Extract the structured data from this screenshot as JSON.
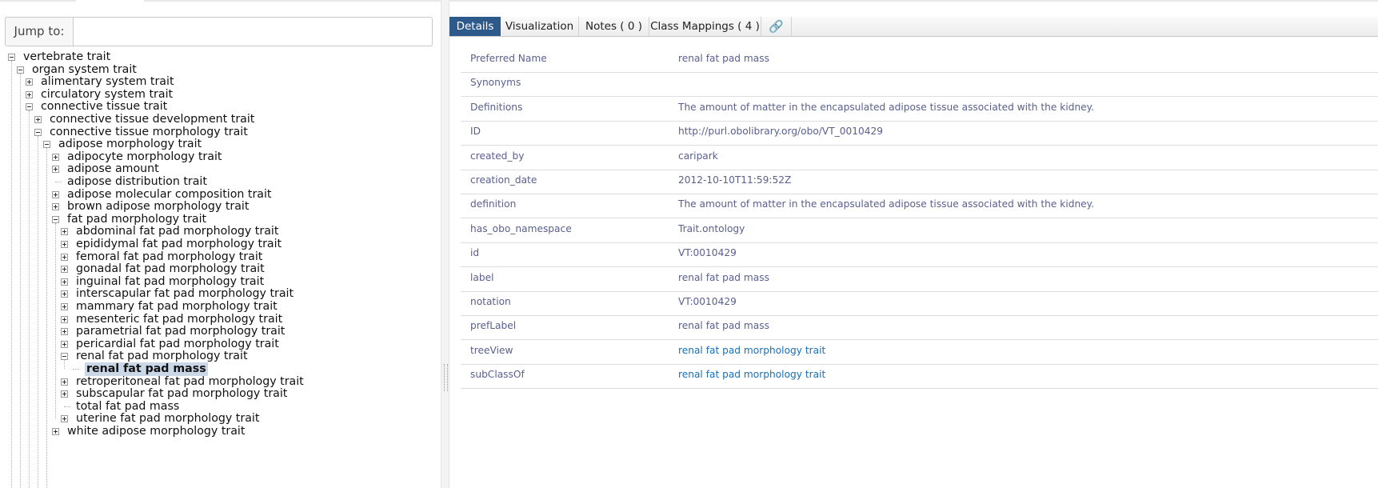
{
  "jump": {
    "label": "Jump to:",
    "value": "",
    "placeholder": ""
  },
  "tree": {
    "nodes": [
      {
        "label": "vertebrate trait",
        "depth": 0,
        "toggle": "minus"
      },
      {
        "label": "organ system trait",
        "depth": 1,
        "toggle": "minus"
      },
      {
        "label": "alimentary system trait",
        "depth": 2,
        "toggle": "plus"
      },
      {
        "label": "circulatory system trait",
        "depth": 2,
        "toggle": "plus"
      },
      {
        "label": "connective tissue trait",
        "depth": 2,
        "toggle": "minus"
      },
      {
        "label": "connective tissue development trait",
        "depth": 3,
        "toggle": "plus"
      },
      {
        "label": "connective tissue morphology trait",
        "depth": 3,
        "toggle": "minus"
      },
      {
        "label": "adipose morphology trait",
        "depth": 4,
        "toggle": "minus"
      },
      {
        "label": "adipocyte morphology trait",
        "depth": 5,
        "toggle": "plus"
      },
      {
        "label": "adipose amount",
        "depth": 5,
        "toggle": "plus"
      },
      {
        "label": "adipose distribution trait",
        "depth": 5,
        "toggle": "leaf"
      },
      {
        "label": "adipose molecular composition trait",
        "depth": 5,
        "toggle": "plus"
      },
      {
        "label": "brown adipose morphology trait",
        "depth": 5,
        "toggle": "plus"
      },
      {
        "label": "fat pad morphology trait",
        "depth": 5,
        "toggle": "minus"
      },
      {
        "label": "abdominal fat pad morphology trait",
        "depth": 6,
        "toggle": "plus"
      },
      {
        "label": "epididymal fat pad morphology trait",
        "depth": 6,
        "toggle": "plus"
      },
      {
        "label": "femoral fat pad morphology trait",
        "depth": 6,
        "toggle": "plus"
      },
      {
        "label": "gonadal fat pad morphology trait",
        "depth": 6,
        "toggle": "plus"
      },
      {
        "label": "inguinal fat pad morphology trait",
        "depth": 6,
        "toggle": "plus"
      },
      {
        "label": "interscapular fat pad morphology trait",
        "depth": 6,
        "toggle": "plus"
      },
      {
        "label": "mammary fat pad morphology trait",
        "depth": 6,
        "toggle": "plus"
      },
      {
        "label": "mesenteric fat pad morphology trait",
        "depth": 6,
        "toggle": "plus"
      },
      {
        "label": "parametrial fat pad morphology trait",
        "depth": 6,
        "toggle": "plus"
      },
      {
        "label": "pericardial fat pad morphology trait",
        "depth": 6,
        "toggle": "plus"
      },
      {
        "label": "renal fat pad morphology trait",
        "depth": 6,
        "toggle": "minus"
      },
      {
        "label": "renal fat pad mass",
        "depth": 7,
        "toggle": "leaf",
        "selected": true
      },
      {
        "label": "retroperitoneal fat pad morphology trait",
        "depth": 6,
        "toggle": "plus"
      },
      {
        "label": "subscapular fat pad morphology trait",
        "depth": 6,
        "toggle": "plus"
      },
      {
        "label": "total fat pad mass",
        "depth": 6,
        "toggle": "leaf"
      },
      {
        "label": "uterine fat pad morphology trait",
        "depth": 6,
        "toggle": "plus"
      },
      {
        "label": "white adipose morphology trait",
        "depth": 5,
        "toggle": "plus"
      }
    ]
  },
  "tabs": [
    {
      "label": "Details",
      "active": true
    },
    {
      "label": "Visualization",
      "active": false
    },
    {
      "label": "Notes ( 0 )",
      "active": false
    },
    {
      "label": "Class Mappings ( 4 )",
      "active": false
    },
    {
      "label": "🔗",
      "icon": "link-icon",
      "active": false
    }
  ],
  "details": [
    {
      "key": "Preferred Name",
      "value": "renal fat pad mass"
    },
    {
      "key": "Synonyms",
      "value": ""
    },
    {
      "key": "Definitions",
      "value": "The amount of matter in the encapsulated adipose tissue associated with the kidney."
    },
    {
      "key": "ID",
      "value": "http://purl.obolibrary.org/obo/VT_0010429"
    },
    {
      "key": "created_by",
      "value": "caripark"
    },
    {
      "key": "creation_date",
      "value": "2012-10-10T11:59:52Z"
    },
    {
      "key": "definition",
      "value": "The amount of matter in the encapsulated adipose tissue associated with the kidney."
    },
    {
      "key": "has_obo_namespace",
      "value": "Trait.ontology"
    },
    {
      "key": "id",
      "value": "VT:0010429"
    },
    {
      "key": "label",
      "value": "renal fat pad mass"
    },
    {
      "key": "notation",
      "value": "VT:0010429"
    },
    {
      "key": "prefLabel",
      "value": "renal fat pad mass"
    },
    {
      "key": "treeView",
      "value": "renal fat pad morphology trait",
      "link": true
    },
    {
      "key": "subClassOf",
      "value": "renal fat pad morphology trait",
      "link": true
    }
  ],
  "colors": {
    "active_tab": "#2e5a8b",
    "detail_text": "#5a5f8f",
    "link": "#1b6fb8",
    "selected_node": "#c9d7e6"
  }
}
